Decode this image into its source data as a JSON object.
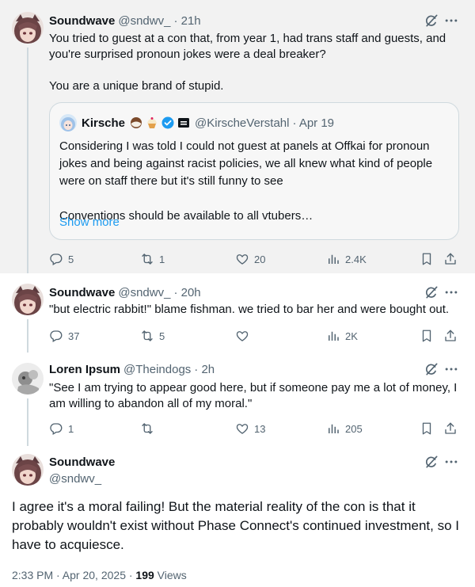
{
  "posts": [
    {
      "name": "Soundwave",
      "handle": "@sndwv_",
      "time": "· 21h",
      "text": "You tried to guest at a con that, from year 1, had trans staff and guests, and you're surprised pronoun jokes were a deal breaker?\n\nYou are a unique brand of stupid.",
      "quote": {
        "name": "Kirsche",
        "badges": [
          "coconut-emoji",
          "cupcake-emoji",
          "verified-badge",
          "affiliate-badge"
        ],
        "handle": "@KirscheVerstahl",
        "time": "· Apr 19",
        "text": "Considering I was told I could not guest at panels at Offkai for pronoun jokes and being against racist policies, we all knew what kind of people were on staff there but it's still funny to see\n\nConventions should be available to all vtubers…",
        "show_more": "Show more"
      },
      "stats": {
        "replies": "5",
        "reposts": "1",
        "likes": "20",
        "views": "2.4K"
      }
    },
    {
      "name": "Soundwave",
      "handle": "@sndwv_",
      "time": "· 20h",
      "text": "\"but electric rabbit!\" blame fishman. we tried to bar her and were bought out.",
      "stats": {
        "replies": "37",
        "reposts": "5",
        "likes": "",
        "views": "2K"
      }
    },
    {
      "name": "Loren Ipsum",
      "handle": "@Theindogs",
      "time": "· 2h",
      "text": "\"See I am trying to appear good here, but if someone pay me a lot of money, I am willing to abandon all of my moral.\"",
      "stats": {
        "replies": "1",
        "reposts": "",
        "likes": "13",
        "views": "205"
      }
    }
  ],
  "main_post": {
    "name": "Soundwave",
    "handle": "@sndwv_",
    "text": "I agree it's a moral failing! But the material reality of the con is that it probably wouldn't exist without Phase Connect's continued investment, so I have to acquiesce.",
    "time": "2:33 PM · Apr 20, 2025 · ",
    "views_count": "199",
    "views_label": " Views"
  },
  "colors": {
    "accent": "#1d9bf0",
    "secondary_text": "#536471",
    "border": "#cfd9de"
  }
}
